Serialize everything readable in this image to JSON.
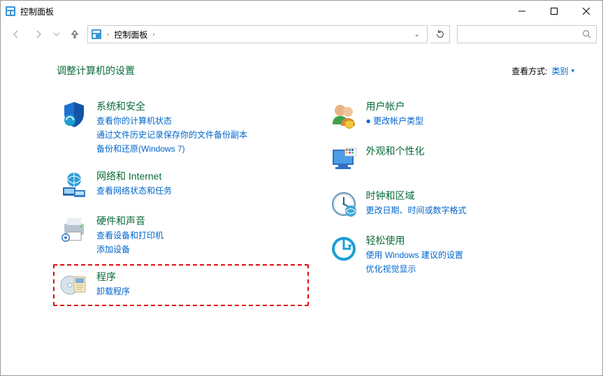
{
  "window": {
    "title": "控制面板"
  },
  "address": {
    "root": "控制面板"
  },
  "header": {
    "adjust": "调整计算机的设置",
    "viewby_label": "查看方式:",
    "viewby_value": "类别"
  },
  "left": [
    {
      "title": "系统和安全",
      "links": [
        "查看你的计算机状态",
        "通过文件历史记录保存你的文件备份副本",
        "备份和还原(Windows 7)"
      ]
    },
    {
      "title": "网络和 Internet",
      "links": [
        "查看网络状态和任务"
      ]
    },
    {
      "title": "硬件和声音",
      "links": [
        "查看设备和打印机",
        "添加设备"
      ]
    },
    {
      "title": "程序",
      "links": [
        "卸载程序"
      ]
    }
  ],
  "right": [
    {
      "title": "用户帐户",
      "links": [
        "● 更改帐户类型"
      ]
    },
    {
      "title": "外观和个性化",
      "links": []
    },
    {
      "title": "时钟和区域",
      "links": [
        "更改日期、时间或数字格式"
      ]
    },
    {
      "title": "轻松使用",
      "links": [
        "使用 Windows 建议的设置",
        "优化视觉显示"
      ]
    }
  ]
}
